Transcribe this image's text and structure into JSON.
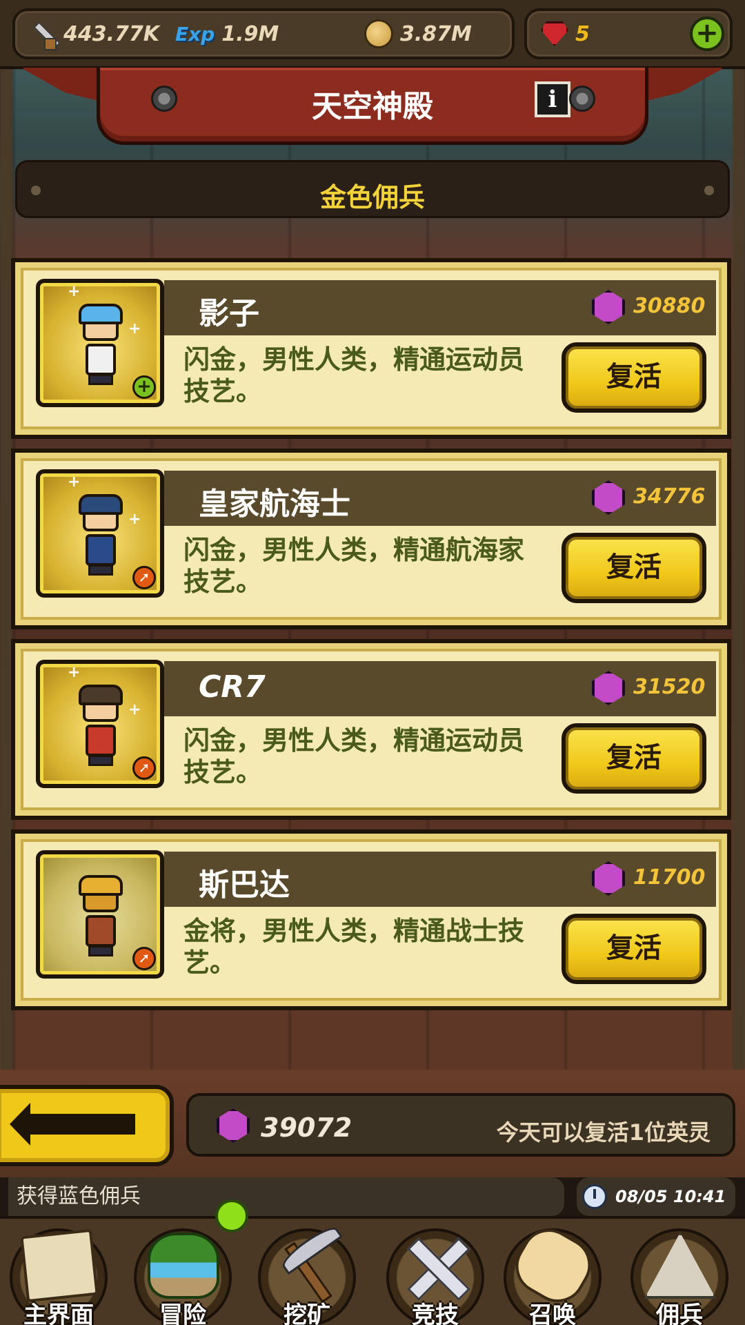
{
  "resources": {
    "attack": "443.77K",
    "exp_label": "Exp",
    "exp": "1.9M",
    "gold": "3.87M",
    "ruby": "5",
    "add_symbol": "+"
  },
  "banner": {
    "title": "天空神殿",
    "info_symbol": "i"
  },
  "section": {
    "title": "金色佣兵"
  },
  "heroes": [
    {
      "name": "影子",
      "price": "30880",
      "desc": "闪金，男性人类，精通运动员技艺。",
      "button": "复活",
      "badge": "plus"
    },
    {
      "name": "皇家航海士",
      "price": "34776",
      "desc": "闪金，男性人类，精通航海家技艺。",
      "button": "复活",
      "badge": "arrow"
    },
    {
      "name": "CR7",
      "price": "31520",
      "desc": "闪金，男性人类，精通运动员技艺。",
      "button": "复活",
      "badge": "arrow"
    },
    {
      "name": "斯巴达",
      "price": "11700",
      "desc": "金将，男性人类，精通战士技艺。",
      "button": "复活",
      "badge": "arrow"
    }
  ],
  "footer": {
    "gem_total": "39072",
    "note": "今天可以复活1位英灵"
  },
  "ticker": {
    "message": "获得蓝色佣兵",
    "time": "08/05 10:41"
  },
  "nav": [
    {
      "label": "主界面",
      "icon": "map-icon"
    },
    {
      "label": "冒险",
      "icon": "island-icon"
    },
    {
      "label": "挖矿",
      "icon": "pickaxe-icon"
    },
    {
      "label": "竞技",
      "icon": "crossed-swords-icon"
    },
    {
      "label": "召唤",
      "icon": "scroll-icon"
    },
    {
      "label": "佣兵",
      "icon": "tent-icon"
    }
  ],
  "colors": {
    "card_bg": "#f5eab4",
    "button_yellow": "#f0c81a",
    "price_gold": "#f3c43a",
    "title_yellow": "#f3d23a",
    "desc_green": "#4a5a1a"
  }
}
